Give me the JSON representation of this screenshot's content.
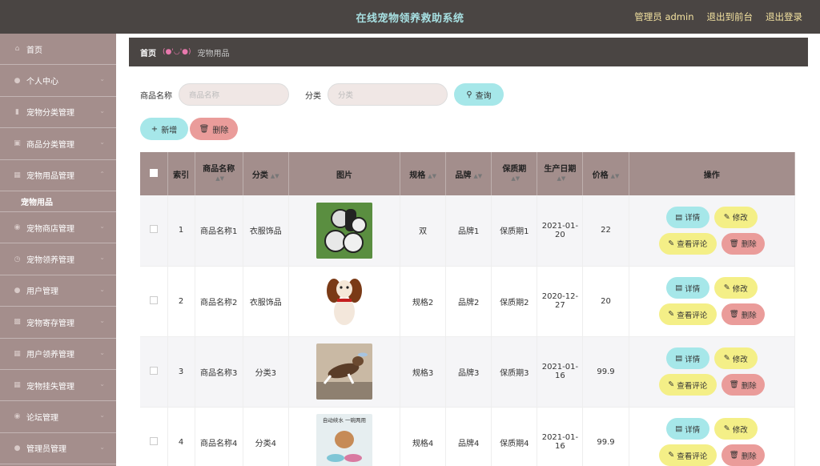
{
  "header": {
    "title": "在线宠物领养救助系统",
    "admin_label": "管理员 admin",
    "front_label": "退出到前台",
    "logout_label": "退出登录"
  },
  "sidebar": {
    "items": [
      {
        "label": "首页",
        "icon": "home-icon"
      },
      {
        "label": "个人中心",
        "icon": "user-icon"
      },
      {
        "label": "宠物分类管理",
        "icon": "bookmark-icon"
      },
      {
        "label": "商品分类管理",
        "icon": "cart-icon"
      },
      {
        "label": "宠物用品管理",
        "icon": "grid-icon"
      },
      {
        "label": "宠物商店管理",
        "icon": "globe-icon"
      },
      {
        "label": "宠物领养管理",
        "icon": "clock-icon"
      },
      {
        "label": "用户管理",
        "icon": "user-icon"
      },
      {
        "label": "宠物寄存管理",
        "icon": "chart-icon"
      },
      {
        "label": "用户领养管理",
        "icon": "grid-icon"
      },
      {
        "label": "宠物挂失管理",
        "icon": "grid-icon"
      },
      {
        "label": "论坛管理",
        "icon": "globe-icon"
      },
      {
        "label": "管理员管理",
        "icon": "user-icon"
      }
    ],
    "active_sub": "宠物用品"
  },
  "breadcrumb": {
    "home": "首页",
    "separator": "(●'◡'●)",
    "current": "宠物用品"
  },
  "search": {
    "name_label": "商品名称",
    "name_placeholder": "商品名称",
    "category_label": "分类",
    "category_placeholder": "分类",
    "query_label": "查询"
  },
  "actions": {
    "add_label": "新增",
    "delete_label": "删除"
  },
  "table": {
    "headers": [
      "索引",
      "商品名称",
      "分类",
      "图片",
      "规格",
      "品牌",
      "保质期",
      "生产日期",
      "价格",
      "操作"
    ],
    "rows": [
      {
        "index": "1",
        "name": "商品名称1",
        "category": "衣服饰品",
        "image": "toy-ball-picture",
        "spec": "双",
        "brand": "品牌1",
        "shelf": "保质期1",
        "date": "2021-01-20",
        "price": "22"
      },
      {
        "index": "2",
        "name": "商品名称2",
        "category": "衣服饰品",
        "image": "spaniel-dog-picture",
        "spec": "规格2",
        "brand": "品牌2",
        "shelf": "保质期2",
        "date": "2020-12-27",
        "price": "20"
      },
      {
        "index": "3",
        "name": "商品名称3",
        "category": "分类3",
        "image": "jumping-dog-picture",
        "spec": "规格3",
        "brand": "品牌3",
        "shelf": "保质期3",
        "date": "2021-01-16",
        "price": "99.9"
      },
      {
        "index": "4",
        "name": "商品名称4",
        "category": "分类4",
        "image": "water-bowl-picture",
        "spec": "规格4",
        "brand": "品牌4",
        "shelf": "保质期4",
        "date": "2021-01-16",
        "price": "99.9"
      }
    ],
    "row_buttons": {
      "detail": "详情",
      "edit": "修改",
      "review": "查看评论",
      "remove": "删除"
    },
    "image4_caption": "自动续水 一碗两用"
  },
  "colors": {
    "topbar": "#4a4543",
    "sidebar": "#a48e8c",
    "accent_cyan": "#a6e7e9",
    "accent_yellow": "#f4ef87",
    "accent_red": "#ea9c9a"
  }
}
